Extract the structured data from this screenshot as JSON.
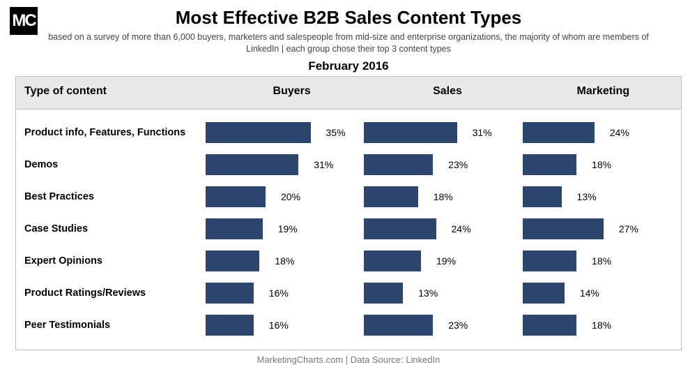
{
  "logo_text": "MC",
  "title": "Most Effective B2B Sales Content Types",
  "subtitle": "based on a survey of more than 6,000 buyers, marketers and salespeople from mid-size and enterprise organizations, the majority of whom are members of LinkedIn | each group chose their top 3 content types",
  "date": "February 2016",
  "header": {
    "type_label": "Type of content",
    "series": [
      "Buyers",
      "Sales",
      "Marketing"
    ]
  },
  "footer": "MarketingCharts.com | Data Source: LinkedIn",
  "chart_data": {
    "type": "bar",
    "title": "Most Effective B2B Sales Content Types",
    "subtitle": "February 2016",
    "xlabel": "",
    "ylabel": "Type of content",
    "xlim": [
      0,
      40
    ],
    "categories": [
      "Product info, Features, Functions",
      "Demos",
      "Best Practices",
      "Case Studies",
      "Expert Opinions",
      "Product Ratings/Reviews",
      "Peer Testimonials"
    ],
    "series": [
      {
        "name": "Buyers",
        "values": [
          35,
          31,
          20,
          19,
          18,
          16,
          16
        ]
      },
      {
        "name": "Sales",
        "values": [
          31,
          23,
          18,
          24,
          19,
          13,
          23
        ]
      },
      {
        "name": "Marketing",
        "values": [
          24,
          18,
          13,
          27,
          18,
          14,
          18
        ]
      }
    ],
    "bar_color": "#2e466e"
  }
}
